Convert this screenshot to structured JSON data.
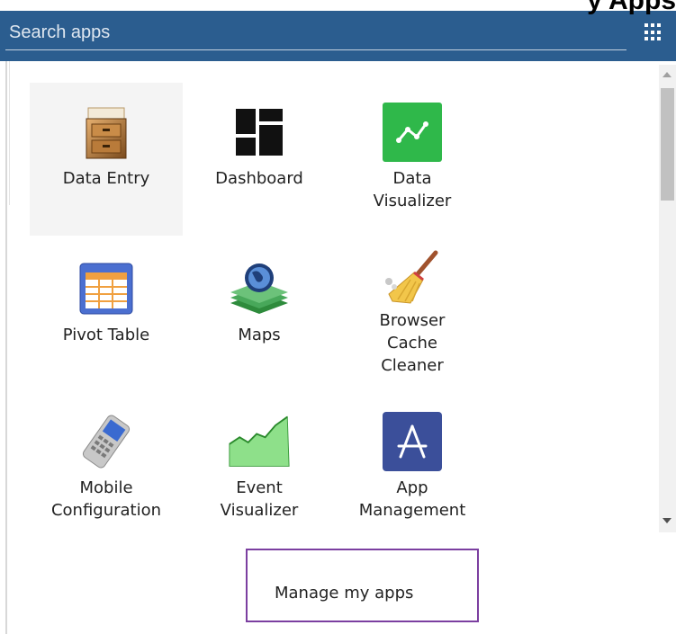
{
  "header": {
    "title": "y Apps",
    "search_placeholder": "Search apps",
    "apps_menu_icon": "grid-icon"
  },
  "apps": [
    {
      "label": "Data Entry",
      "icon": "data-entry-icon",
      "active": true
    },
    {
      "label": "Dashboard",
      "icon": "dashboard-icon"
    },
    {
      "label": "Data\nVisualizer",
      "icon": "data-visualizer-icon"
    },
    {
      "label": "Pivot Table",
      "icon": "pivot-table-icon"
    },
    {
      "label": "Maps",
      "icon": "maps-icon"
    },
    {
      "label": "Browser\nCache\nCleaner",
      "icon": "cache-cleaner-icon"
    },
    {
      "label": "Mobile\nConfiguration",
      "icon": "mobile-configuration-icon"
    },
    {
      "label": "Event\nVisualizer",
      "icon": "event-visualizer-icon"
    },
    {
      "label": "App\nManagement",
      "icon": "app-management-icon"
    }
  ],
  "footer": {
    "manage_label": "Manage my apps"
  },
  "colors": {
    "header_bg": "#2b5d8f",
    "highlight_border": "#7b3fa0"
  }
}
